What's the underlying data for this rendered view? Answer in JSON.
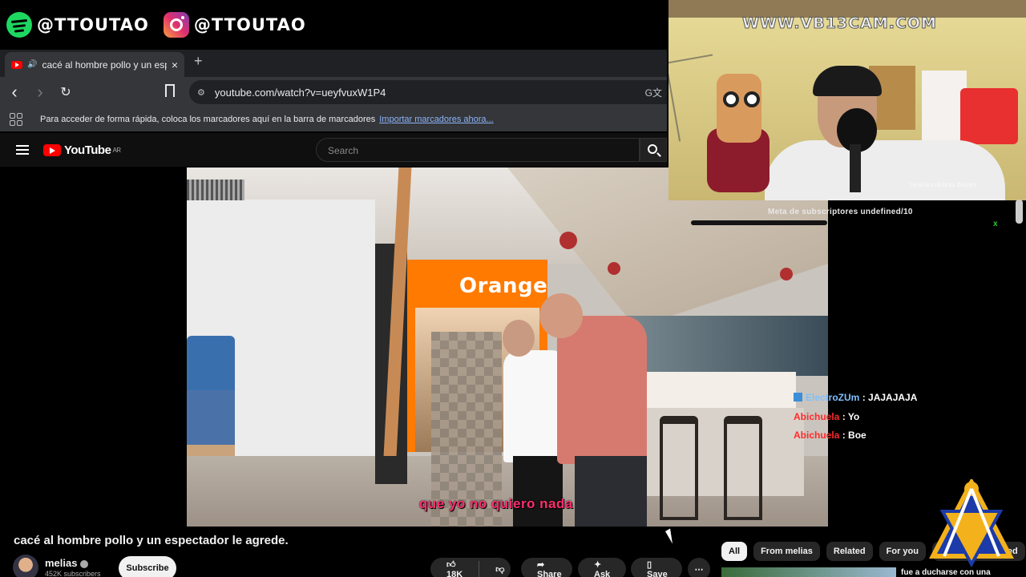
{
  "overlay": {
    "spotify_handle": "@TTOUTAO",
    "instagram_handle": "@TTOUTAO",
    "cam_watermark": "WWW.VB13CAM.COM",
    "cam_mirror_text": "ɔɐɯlɐoɹbʇɐɯ buᴉsn",
    "sub_goal": "Meta de subscriptores undefined/10",
    "goal_marker": "x"
  },
  "browser": {
    "tab_title": "cacé al hombre pollo y un espectador le agrede.",
    "tab_close": "×",
    "new_tab": "+",
    "nav_back": "‹",
    "nav_forward": "›",
    "nav_reload": "↻",
    "url": "youtube.com/watch?v=ueyfvuxW1P4",
    "translate_icon": "G文",
    "bookmarks_prompt": "Para acceder de forma rápida, coloca los marcadores aquí en la barra de marcadores",
    "import_link": "Importar marcadores ahora..."
  },
  "youtube": {
    "logo_text": "YouTube",
    "logo_region": "AR",
    "search_placeholder": "Search",
    "subtitle": "que yo no quiero nada",
    "store_sign": "Orange",
    "video_title": "cacé al hombre pollo y un espectador le agrede.",
    "channel_name": "melias",
    "channel_subs": "452K subscribers",
    "subscribe_label": "Subscribe",
    "like_count": "18K",
    "share_label": "Share",
    "ask_label": "Ask",
    "save_label": "Save",
    "more_label": "⋯",
    "chips": [
      "All",
      "From melias",
      "Related",
      "For you",
      "Recently uploaded"
    ],
    "reco_title": "fue a ducharse con una"
  },
  "chat": [
    {
      "user": "ElectroZUm",
      "message": "JAJAJAJA",
      "badge": true,
      "color": "#7fc0ff"
    },
    {
      "user": "Abichuela",
      "message": "Yo",
      "badge": false,
      "color": "#ff2a2a"
    },
    {
      "user": "Abichuela",
      "message": "Boe",
      "badge": false,
      "color": "#ff2a2a"
    }
  ],
  "colors": {
    "spotify": "#1ed760",
    "youtube_red": "#ff0000",
    "subtitle": "#ff2d6f",
    "goal_marker": "#20d020"
  }
}
